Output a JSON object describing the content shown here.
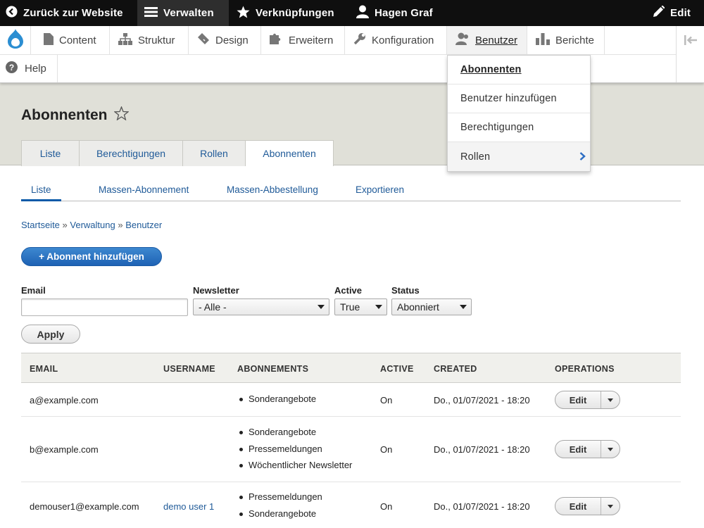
{
  "toolbar": {
    "back": "Zurück zur Website",
    "manage": "Verwalten",
    "shortcuts": "Verknüpfungen",
    "user": "Hagen Graf",
    "edit": "Edit"
  },
  "tray": {
    "items": [
      "Content",
      "Struktur",
      "Design",
      "Erweitern",
      "Konfiguration",
      "Benutzer",
      "Berichte"
    ],
    "help": "Help"
  },
  "dropdown": {
    "items": [
      "Abonnenten",
      "Benutzer hinzufügen",
      "Berechtigungen",
      "Rollen"
    ]
  },
  "page": {
    "title": "Abonnenten"
  },
  "tabs": [
    "Liste",
    "Berechtigungen",
    "Rollen",
    "Abonnenten"
  ],
  "subtabs": [
    "Liste",
    "Massen-Abonnement",
    "Massen-Abbestellung",
    "Exportieren"
  ],
  "breadcrumb": {
    "items": [
      "Startseite",
      "Verwaltung",
      "Benutzer"
    ],
    "sep": " » "
  },
  "add_button": "+ Abonnent hinzufügen",
  "filters": {
    "email_label": "Email",
    "email_value": "",
    "newsletter_label": "Newsletter",
    "newsletter_value": "- Alle -",
    "active_label": "Active",
    "active_value": "True",
    "status_label": "Status",
    "status_value": "Abonniert",
    "apply": "Apply"
  },
  "table": {
    "headers": [
      "EMAIL",
      "USERNAME",
      "ABONNEMENTS",
      "ACTIVE",
      "CREATED",
      "OPERATIONS"
    ],
    "rows": [
      {
        "email": "a@example.com",
        "username": "",
        "subs": [
          "Sonderangebote"
        ],
        "active": "On",
        "created": "Do., 01/07/2021 - 18:20",
        "op": "Edit"
      },
      {
        "email": "b@example.com",
        "username": "",
        "subs": [
          "Sonderangebote",
          "Pressemeldungen",
          "Wöchentlicher Newsletter"
        ],
        "active": "On",
        "created": "Do., 01/07/2021 - 18:20",
        "op": "Edit"
      },
      {
        "email": "demouser1@example.com",
        "username": "demo user 1",
        "subs": [
          "Pressemeldungen",
          "Sonderangebote"
        ],
        "active": "On",
        "created": "Do., 01/07/2021 - 18:20",
        "op": "Edit"
      }
    ]
  }
}
